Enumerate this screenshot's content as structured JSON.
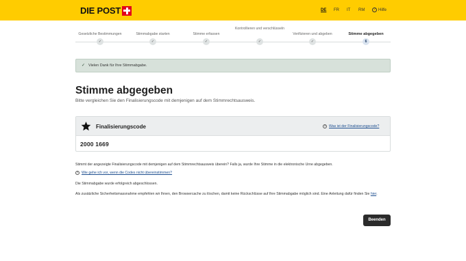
{
  "header": {
    "logo_text": "DIE POST",
    "languages": [
      "DE",
      "FR",
      "IT",
      "RM"
    ],
    "active_language": "DE",
    "help_label": "Hilfe",
    "background": "#ffcc00"
  },
  "steps": [
    {
      "label": "Gesetzliche Bestimmungen",
      "status": "done"
    },
    {
      "label": "Stimmabgabe starten",
      "status": "done"
    },
    {
      "label": "Stimme erfassen",
      "status": "done"
    },
    {
      "label": "Kontrollieren und verschlüsseln",
      "status": "done"
    },
    {
      "label": "Verifizieren und abgeben",
      "status": "done"
    },
    {
      "label": "Stimme abgegeben",
      "status": "current",
      "number": "6"
    }
  ],
  "alert": {
    "icon": "check-icon",
    "text": "Vielen Dank für Ihre Stimmabgabe."
  },
  "main": {
    "title": "Stimme abgegeben",
    "subtitle": "Bitte vergleichen Sie den Finalisierungscode mit demjenigen auf dem Stimmrechtsausweis."
  },
  "code_card": {
    "title": "Finalisierungscode",
    "help_link": "Was ist der Finalisierungscode?",
    "code": "2000 1669"
  },
  "texts": {
    "compare_info": "Stimmt der angezeigte Finalisierungscode mit demjenigen auf dem Stimmrechtsausweis überein? Falls ja, wurde Ihre Stimme in die elektronische Urne abgegeben.",
    "mismatch_link": "Wie gehe ich vor, wenn die Codes nicht übereinstimmen?",
    "completed": "Die Stimmabgabe wurde erfolgreich abgeschlossen.",
    "security_note": "Als zusätzliche Sicherheitsmassnahme empfehlen wir Ihnen, den Browsercache zu löschen, damit keine Rückschlüsse auf Ihre Stimmabgabe möglich sind. Eine Anleitung dafür finden Sie",
    "security_link": "hier",
    "security_end": "."
  },
  "actions": {
    "finish_label": "Beenden"
  }
}
